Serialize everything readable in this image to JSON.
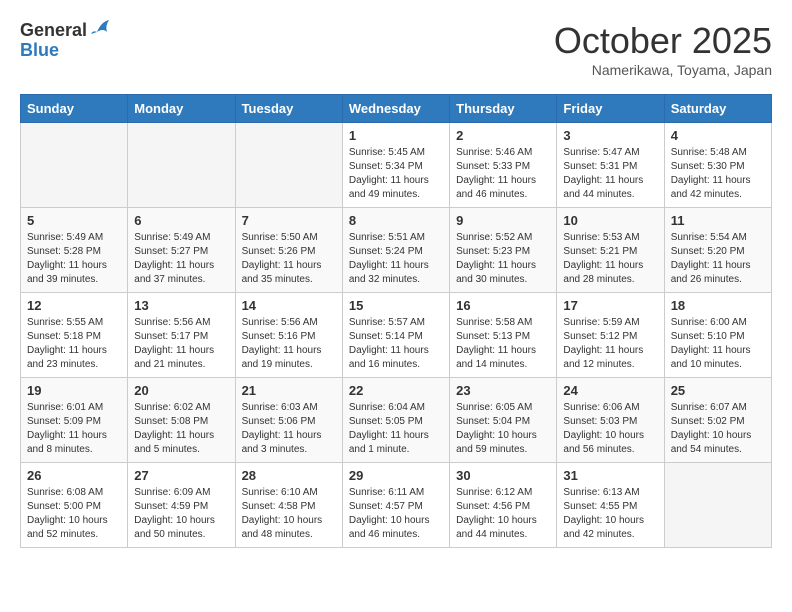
{
  "header": {
    "logo_line1": "General",
    "logo_line2": "Blue",
    "month_title": "October 2025",
    "location": "Namerikawa, Toyama, Japan"
  },
  "weekdays": [
    "Sunday",
    "Monday",
    "Tuesday",
    "Wednesday",
    "Thursday",
    "Friday",
    "Saturday"
  ],
  "weeks": [
    {
      "days": [
        {
          "num": "",
          "info": ""
        },
        {
          "num": "",
          "info": ""
        },
        {
          "num": "",
          "info": ""
        },
        {
          "num": "1",
          "info": "Sunrise: 5:45 AM\nSunset: 5:34 PM\nDaylight: 11 hours\nand 49 minutes."
        },
        {
          "num": "2",
          "info": "Sunrise: 5:46 AM\nSunset: 5:33 PM\nDaylight: 11 hours\nand 46 minutes."
        },
        {
          "num": "3",
          "info": "Sunrise: 5:47 AM\nSunset: 5:31 PM\nDaylight: 11 hours\nand 44 minutes."
        },
        {
          "num": "4",
          "info": "Sunrise: 5:48 AM\nSunset: 5:30 PM\nDaylight: 11 hours\nand 42 minutes."
        }
      ]
    },
    {
      "days": [
        {
          "num": "5",
          "info": "Sunrise: 5:49 AM\nSunset: 5:28 PM\nDaylight: 11 hours\nand 39 minutes."
        },
        {
          "num": "6",
          "info": "Sunrise: 5:49 AM\nSunset: 5:27 PM\nDaylight: 11 hours\nand 37 minutes."
        },
        {
          "num": "7",
          "info": "Sunrise: 5:50 AM\nSunset: 5:26 PM\nDaylight: 11 hours\nand 35 minutes."
        },
        {
          "num": "8",
          "info": "Sunrise: 5:51 AM\nSunset: 5:24 PM\nDaylight: 11 hours\nand 32 minutes."
        },
        {
          "num": "9",
          "info": "Sunrise: 5:52 AM\nSunset: 5:23 PM\nDaylight: 11 hours\nand 30 minutes."
        },
        {
          "num": "10",
          "info": "Sunrise: 5:53 AM\nSunset: 5:21 PM\nDaylight: 11 hours\nand 28 minutes."
        },
        {
          "num": "11",
          "info": "Sunrise: 5:54 AM\nSunset: 5:20 PM\nDaylight: 11 hours\nand 26 minutes."
        }
      ]
    },
    {
      "days": [
        {
          "num": "12",
          "info": "Sunrise: 5:55 AM\nSunset: 5:18 PM\nDaylight: 11 hours\nand 23 minutes."
        },
        {
          "num": "13",
          "info": "Sunrise: 5:56 AM\nSunset: 5:17 PM\nDaylight: 11 hours\nand 21 minutes."
        },
        {
          "num": "14",
          "info": "Sunrise: 5:56 AM\nSunset: 5:16 PM\nDaylight: 11 hours\nand 19 minutes."
        },
        {
          "num": "15",
          "info": "Sunrise: 5:57 AM\nSunset: 5:14 PM\nDaylight: 11 hours\nand 16 minutes."
        },
        {
          "num": "16",
          "info": "Sunrise: 5:58 AM\nSunset: 5:13 PM\nDaylight: 11 hours\nand 14 minutes."
        },
        {
          "num": "17",
          "info": "Sunrise: 5:59 AM\nSunset: 5:12 PM\nDaylight: 11 hours\nand 12 minutes."
        },
        {
          "num": "18",
          "info": "Sunrise: 6:00 AM\nSunset: 5:10 PM\nDaylight: 11 hours\nand 10 minutes."
        }
      ]
    },
    {
      "days": [
        {
          "num": "19",
          "info": "Sunrise: 6:01 AM\nSunset: 5:09 PM\nDaylight: 11 hours\nand 8 minutes."
        },
        {
          "num": "20",
          "info": "Sunrise: 6:02 AM\nSunset: 5:08 PM\nDaylight: 11 hours\nand 5 minutes."
        },
        {
          "num": "21",
          "info": "Sunrise: 6:03 AM\nSunset: 5:06 PM\nDaylight: 11 hours\nand 3 minutes."
        },
        {
          "num": "22",
          "info": "Sunrise: 6:04 AM\nSunset: 5:05 PM\nDaylight: 11 hours\nand 1 minute."
        },
        {
          "num": "23",
          "info": "Sunrise: 6:05 AM\nSunset: 5:04 PM\nDaylight: 10 hours\nand 59 minutes."
        },
        {
          "num": "24",
          "info": "Sunrise: 6:06 AM\nSunset: 5:03 PM\nDaylight: 10 hours\nand 56 minutes."
        },
        {
          "num": "25",
          "info": "Sunrise: 6:07 AM\nSunset: 5:02 PM\nDaylight: 10 hours\nand 54 minutes."
        }
      ]
    },
    {
      "days": [
        {
          "num": "26",
          "info": "Sunrise: 6:08 AM\nSunset: 5:00 PM\nDaylight: 10 hours\nand 52 minutes."
        },
        {
          "num": "27",
          "info": "Sunrise: 6:09 AM\nSunset: 4:59 PM\nDaylight: 10 hours\nand 50 minutes."
        },
        {
          "num": "28",
          "info": "Sunrise: 6:10 AM\nSunset: 4:58 PM\nDaylight: 10 hours\nand 48 minutes."
        },
        {
          "num": "29",
          "info": "Sunrise: 6:11 AM\nSunset: 4:57 PM\nDaylight: 10 hours\nand 46 minutes."
        },
        {
          "num": "30",
          "info": "Sunrise: 6:12 AM\nSunset: 4:56 PM\nDaylight: 10 hours\nand 44 minutes."
        },
        {
          "num": "31",
          "info": "Sunrise: 6:13 AM\nSunset: 4:55 PM\nDaylight: 10 hours\nand 42 minutes."
        },
        {
          "num": "",
          "info": ""
        }
      ]
    }
  ]
}
